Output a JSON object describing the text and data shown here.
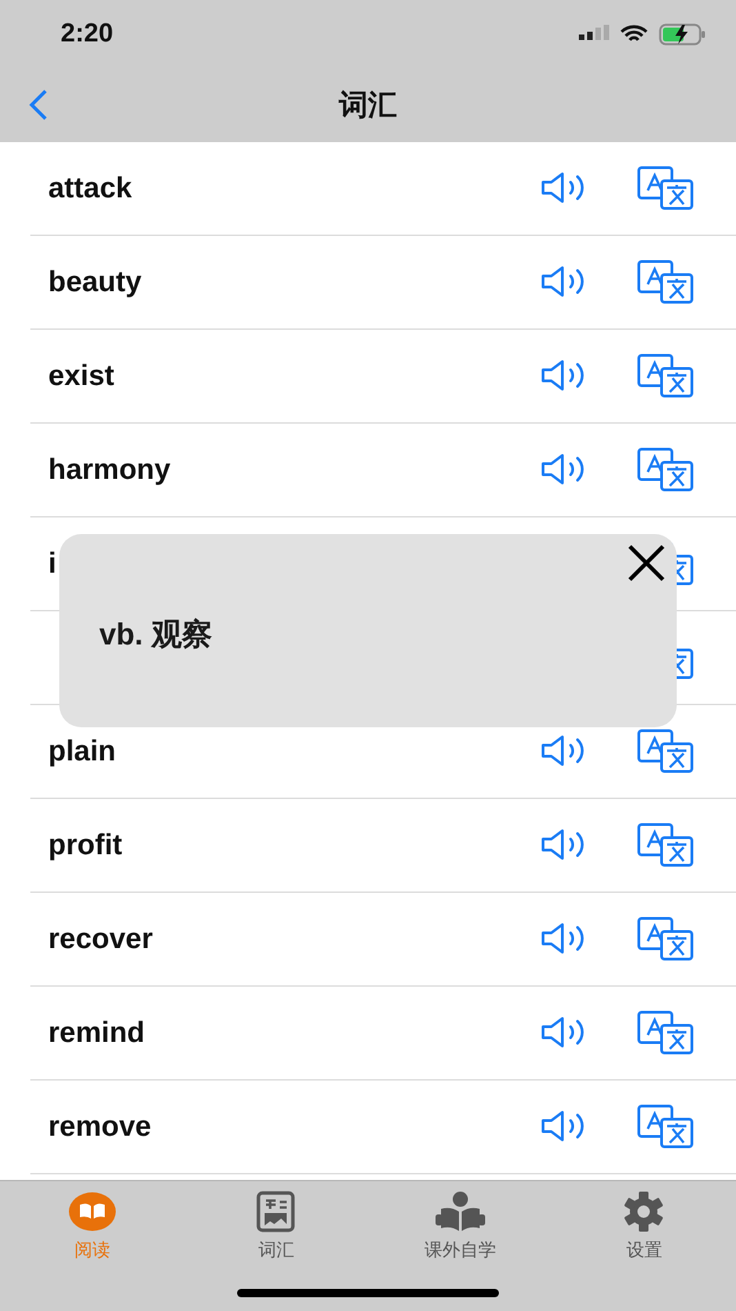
{
  "status_bar": {
    "time": "2:20"
  },
  "nav": {
    "title": "词汇"
  },
  "words": [
    {
      "word": "attack",
      "kind": "word"
    },
    {
      "word": "beauty",
      "kind": "word"
    },
    {
      "word": "exist",
      "kind": "word"
    },
    {
      "word": "harmony",
      "kind": "word"
    },
    {
      "word": "i",
      "kind": "covered"
    },
    {
      "kind": "covered"
    },
    {
      "word": "plain",
      "kind": "word"
    },
    {
      "word": "profit",
      "kind": "word"
    },
    {
      "word": "recover",
      "kind": "word"
    },
    {
      "word": "remind",
      "kind": "word"
    },
    {
      "word": "remove",
      "kind": "word"
    }
  ],
  "popup": {
    "text": "vb. 观察"
  },
  "tabs": [
    {
      "label": "阅读",
      "selected": true,
      "kind": "book"
    },
    {
      "label": "词汇",
      "selected": false,
      "kind": "card"
    },
    {
      "label": "课外自学",
      "selected": false,
      "kind": "reader"
    },
    {
      "label": "设置",
      "selected": false,
      "kind": "gear"
    }
  ]
}
